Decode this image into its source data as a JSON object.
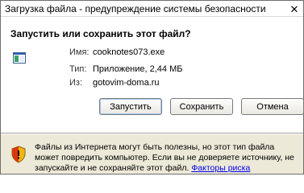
{
  "window": {
    "title": "Загрузка файла - предупреждение системы безопасности",
    "close_glyph": "✕"
  },
  "prompt": {
    "question": "Запустить или сохранить этот файл?"
  },
  "file_info": {
    "name_label": "Имя:",
    "name_value": "cooknotes073.exe",
    "type_label": "Тип:",
    "type_value": "Приложение, 2,44 МБ",
    "from_label": "Из:",
    "from_value": "gotovim-doma.ru",
    "icon": "file-executable-icon"
  },
  "buttons": {
    "run": "Запустить",
    "save": "Сохранить",
    "cancel": "Отмена"
  },
  "warning": {
    "icon": "security-shield-icon",
    "text": "Файлы из Интернета могут быть полезны, но этот тип файла может повредить компьютер. Если вы не доверяете источнику, не запускайте и не сохраняйте этот файл.",
    "link": "Факторы риска"
  },
  "colors": {
    "dialog_bg": "#ece9d8",
    "link": "#0000ee"
  }
}
